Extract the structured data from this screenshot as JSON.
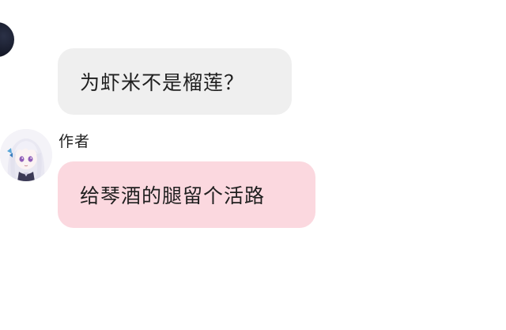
{
  "messages": [
    {
      "sender": "",
      "text": "为虾米不是榴莲？",
      "bubble_color": "#efefef"
    },
    {
      "sender": "作者",
      "text": "给琴酒的腿留个活路",
      "bubble_color": "#fbd8df"
    }
  ],
  "icons": {
    "top_avatar": "avatar",
    "bottom_avatar": "anime-girl-avatar"
  }
}
